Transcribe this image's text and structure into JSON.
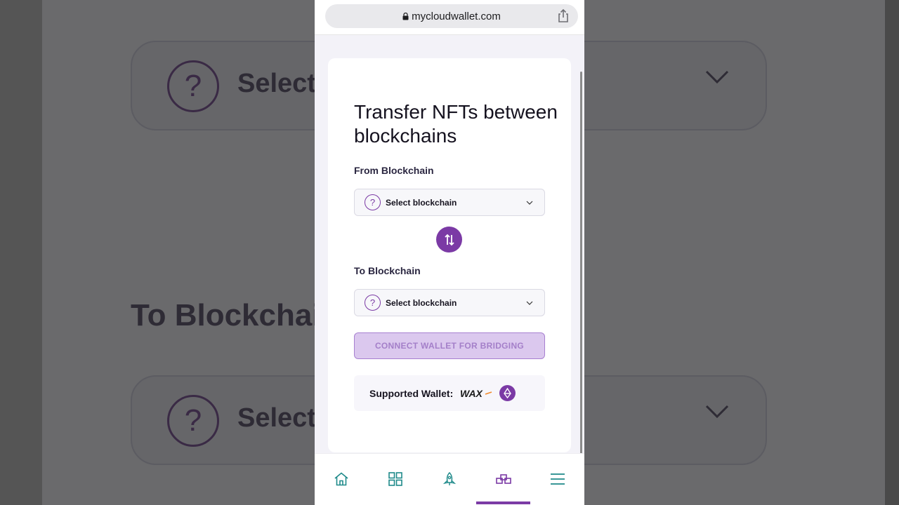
{
  "browser": {
    "url": "mycloudwallet.com",
    "lock_icon": "lock-icon",
    "share_icon": "share-icon"
  },
  "background": {
    "select_text": "Select",
    "to_label": "To Blockchai"
  },
  "page": {
    "title": "Transfer NFTs between blockchains",
    "from_label": "From Blockchain",
    "from_select": "Select blockchain",
    "to_label": "To Blockchain",
    "to_select": "Select blockchain",
    "swap_icon": "swap-arrows-icon",
    "connect_button": "CONNECT WALLET FOR BRIDGING",
    "supported_wallet_label": "Supported Wallet:",
    "wallet_logo": "WAX"
  },
  "nav": {
    "items": [
      {
        "icon": "home-icon"
      },
      {
        "icon": "grid-icon"
      },
      {
        "icon": "rocket-icon"
      },
      {
        "icon": "bridge-icon",
        "active": true
      },
      {
        "icon": "menu-icon"
      }
    ]
  },
  "colors": {
    "accent": "#7b3aa5",
    "connect_bg": "#dbc8ee",
    "nav_icon": "#1f8a8a"
  }
}
